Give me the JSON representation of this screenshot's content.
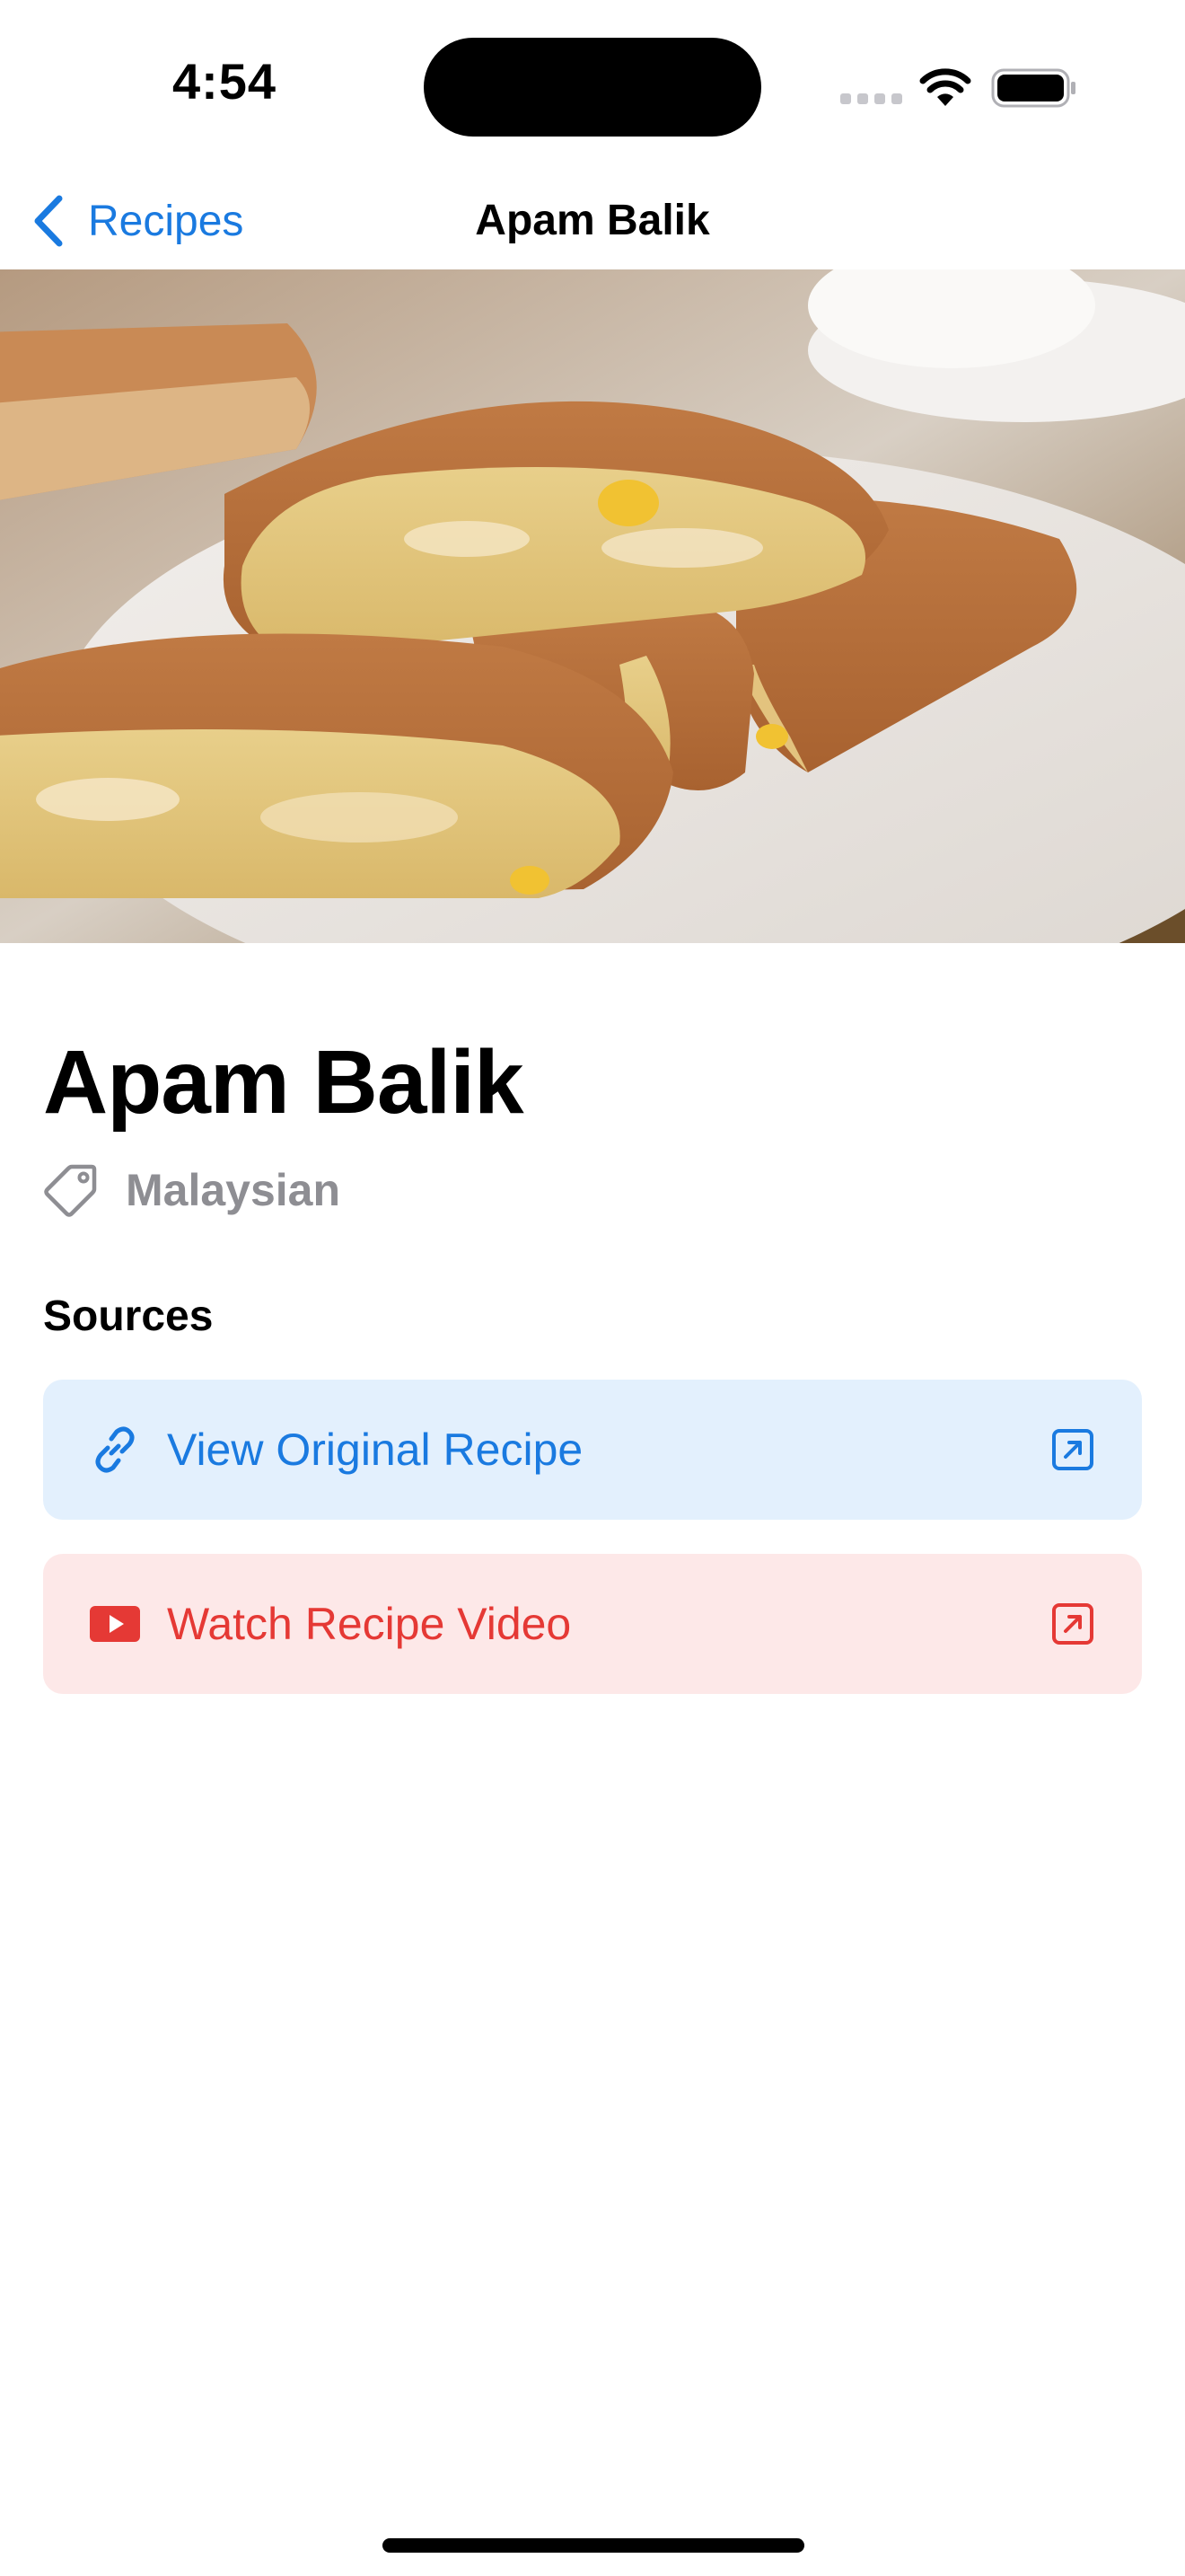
{
  "status_bar": {
    "time": "4:54"
  },
  "nav": {
    "back_label": "Recipes",
    "title": "Apam Balik"
  },
  "recipe": {
    "name": "Apam Balik",
    "cuisine": "Malaysian",
    "hero_image": "apam-balik-photo"
  },
  "sources": {
    "heading": "Sources",
    "original": {
      "label": "View Original Recipe",
      "icon": "link-icon",
      "color": "#1a73e8",
      "background": "#e3f0fd"
    },
    "video": {
      "label": "Watch Recipe Video",
      "icon": "youtube-icon",
      "color": "#e53935",
      "background": "#fde8e8"
    }
  },
  "colors": {
    "accent": "#1a73e8",
    "secondary_text": "#8e8e93",
    "video_red": "#e53935"
  }
}
